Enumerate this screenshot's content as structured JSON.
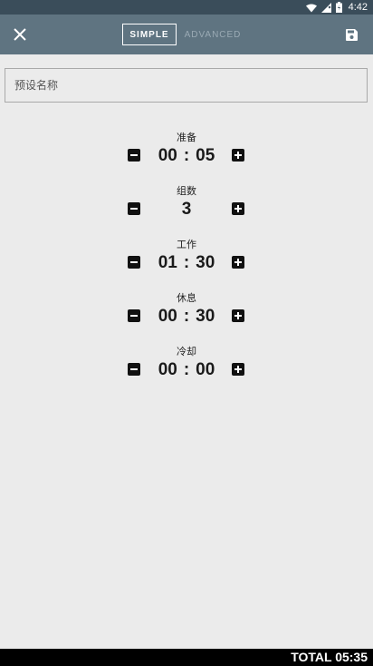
{
  "status_bar": {
    "time": "4:42",
    "icons": [
      "wifi-icon",
      "signal-icon",
      "battery-icon"
    ]
  },
  "toolbar": {
    "close_icon": "close-icon",
    "save_icon": "save-icon",
    "tabs": [
      {
        "label": "SIMPLE",
        "active": true
      },
      {
        "label": "ADVANCED",
        "active": false
      }
    ]
  },
  "preset_name": {
    "placeholder": "预设名称",
    "value": ""
  },
  "fields": [
    {
      "label": "准备",
      "minutes": "00",
      "seconds": "05"
    },
    {
      "label": "组数",
      "count": "3"
    },
    {
      "label": "工作",
      "minutes": "01",
      "seconds": "30"
    },
    {
      "label": "休息",
      "minutes": "00",
      "seconds": "30"
    },
    {
      "label": "冷却",
      "minutes": "00",
      "seconds": "00"
    }
  ],
  "footer": {
    "total": "TOTAL 05:35"
  },
  "colors": {
    "status_bar": "#3a4d5a",
    "toolbar": "#5f7481",
    "background": "#ebebeb",
    "footer": "#000000"
  }
}
